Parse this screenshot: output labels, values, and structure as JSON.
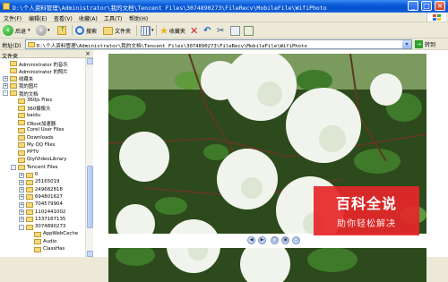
{
  "window": {
    "title": "D:\\个人资料管理\\Administrator\\我的文档\\Tencent Files\\3074890273\\FileRecv\\MobileFile\\WifiPhoto"
  },
  "menu": [
    "文件(F)",
    "编辑(E)",
    "查看(V)",
    "收藏(A)",
    "工具(T)",
    "帮助(H)"
  ],
  "toolbar": {
    "back_label": "后退",
    "search_label": "搜索",
    "folders_label": "文件夹",
    "favorites_label": "收藏夹"
  },
  "address": {
    "label": "地址(D)",
    "path": "D:\\个人资料管理\\Administrator\\我的文档\\Tencent Files\\3074890273\\FileRecv\\MobileFile\\WifiPhoto",
    "go_label": "转到"
  },
  "folder_pane": {
    "title": "文件夹",
    "tree": [
      {
        "label": "Administrator 的音乐",
        "indent": 0,
        "exp": ""
      },
      {
        "label": "Administrator 的照片",
        "indent": 0,
        "exp": ""
      },
      {
        "label": "收藏夹",
        "indent": 0,
        "exp": "+"
      },
      {
        "label": "我的图片",
        "indent": 0,
        "exp": "+"
      },
      {
        "label": "我的文档",
        "indent": 0,
        "exp": "-"
      },
      {
        "label": "360js Files",
        "indent": 1,
        "exp": ""
      },
      {
        "label": "360摄像头",
        "indent": 1,
        "exp": ""
      },
      {
        "label": "baidu",
        "indent": 1,
        "exp": ""
      },
      {
        "label": "CRoot加速器",
        "indent": 1,
        "exp": ""
      },
      {
        "label": "Corel User Files",
        "indent": 1,
        "exp": ""
      },
      {
        "label": "Downloads",
        "indent": 1,
        "exp": ""
      },
      {
        "label": "My QQ Files",
        "indent": 1,
        "exp": ""
      },
      {
        "label": "PPTV",
        "indent": 1,
        "exp": ""
      },
      {
        "label": "QiyiVideoLibrary",
        "indent": 1,
        "exp": ""
      },
      {
        "label": "Tencent Files",
        "indent": 1,
        "exp": "-"
      },
      {
        "label": "0",
        "indent": 2,
        "exp": "+"
      },
      {
        "label": "25165019",
        "indent": 2,
        "exp": "+"
      },
      {
        "label": "249682818",
        "indent": 2,
        "exp": "+"
      },
      {
        "label": "694801627",
        "indent": 2,
        "exp": "+"
      },
      {
        "label": "704579904",
        "indent": 2,
        "exp": "+"
      },
      {
        "label": "1102441002",
        "indent": 2,
        "exp": "+"
      },
      {
        "label": "1337167135",
        "indent": 2,
        "exp": "+"
      },
      {
        "label": "3074890273",
        "indent": 2,
        "exp": "-"
      },
      {
        "label": "AppWebCache",
        "indent": 3,
        "exp": ""
      },
      {
        "label": "Audio",
        "indent": 3,
        "exp": ""
      },
      {
        "label": "ClassHas",
        "indent": 3,
        "exp": ""
      }
    ]
  },
  "watermark": {
    "title": "百科全说",
    "subtitle": "助你轻松解决"
  }
}
